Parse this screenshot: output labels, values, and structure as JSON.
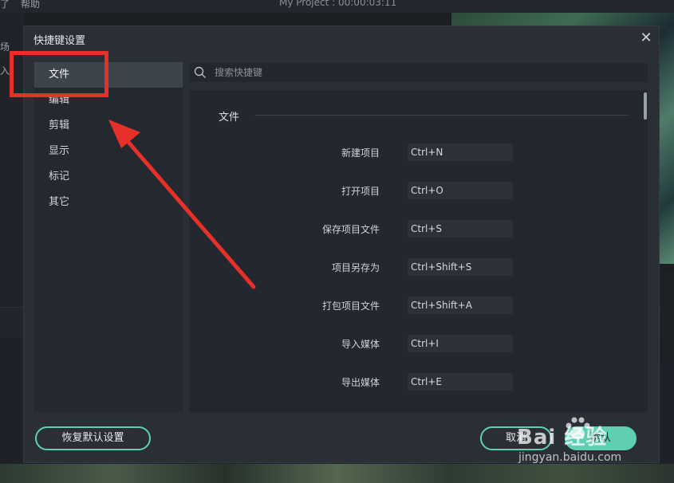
{
  "background": {
    "menu_items": [
      "了",
      "帮助"
    ],
    "project_title": "My Project : 00:00:03:11",
    "left_panel_texts": [
      "场",
      "入"
    ]
  },
  "dialog": {
    "title": "快捷键设置",
    "close_icon": "close-icon",
    "sidebar": {
      "items": [
        {
          "label": "文件",
          "active": true
        },
        {
          "label": "编辑",
          "active": false
        },
        {
          "label": "剪辑",
          "active": false
        },
        {
          "label": "显示",
          "active": false
        },
        {
          "label": "标记",
          "active": false
        },
        {
          "label": "其它",
          "active": false
        }
      ]
    },
    "search": {
      "placeholder": "搜索快捷键",
      "value": "",
      "icon": "search-icon"
    },
    "section": {
      "title": "文件",
      "rows": [
        {
          "label": "新建项目",
          "key": "Ctrl+N"
        },
        {
          "label": "打开项目",
          "key": "Ctrl+O"
        },
        {
          "label": "保存项目文件",
          "key": "Ctrl+S"
        },
        {
          "label": "项目另存为",
          "key": "Ctrl+Shift+S"
        },
        {
          "label": "打包项目文件",
          "key": "Ctrl+Shift+A"
        },
        {
          "label": "导入媒体",
          "key": "Ctrl+I"
        },
        {
          "label": "导出媒体",
          "key": "Ctrl+E"
        }
      ]
    },
    "buttons": {
      "reset": "恢复默认设置",
      "cancel": "取消",
      "ok": "确认"
    }
  },
  "watermark": {
    "main": "Bai 经验",
    "sub": "jingyan.baidu.com"
  },
  "colors": {
    "accent": "#5fcfb4",
    "annotation": "#e8302a",
    "dialog_bg": "#2a2f36",
    "panel_bg": "#23282e"
  }
}
